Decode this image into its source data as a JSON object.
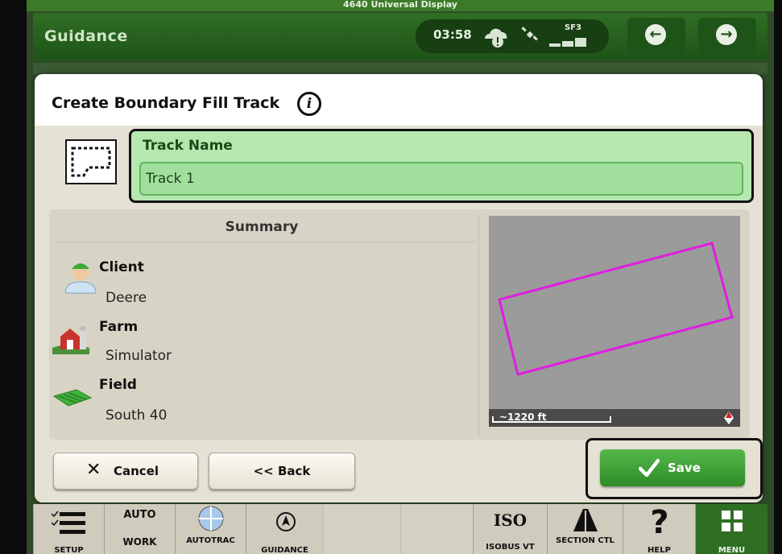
{
  "display_title": "4640 Universal Display",
  "header": {
    "title": "Guidance",
    "clock": "03:58",
    "gps_status": "SF3",
    "back_icon": "arrow-left-circle-icon",
    "forward_icon": "arrow-right-circle-icon"
  },
  "dialog": {
    "title": "Create Boundary Fill Track",
    "track_name_label": "Track Name",
    "track_name_value": "Track 1",
    "summary": {
      "title": "Summary",
      "items": [
        {
          "label": "Client",
          "value": "Deere",
          "icon": "client-person-icon"
        },
        {
          "label": "Farm",
          "value": "Simulator",
          "icon": "farm-barn-icon"
        },
        {
          "label": "Field",
          "value": "South 40",
          "icon": "field-icon"
        }
      ]
    },
    "map": {
      "scale": "~1220 ft",
      "boundary_color": "#e01ee0",
      "background_color": "#9b9b9b"
    },
    "buttons": {
      "cancel": "Cancel",
      "back": "<< Back",
      "save": "Save"
    }
  },
  "bottom_bar": {
    "items": [
      {
        "label": "SETUP"
      },
      {
        "label": "WORK",
        "top": "AUTO"
      },
      {
        "label": "AUTOTRAC"
      },
      {
        "label": "GUIDANCE"
      },
      {
        "label": ""
      },
      {
        "label": ""
      },
      {
        "label": "ISOBUS VT",
        "top": "ISO"
      },
      {
        "label": "SECTION CTL"
      },
      {
        "label": "HELP"
      },
      {
        "label": "MENU"
      }
    ]
  },
  "colors": {
    "john_deere_green": "#367c2b",
    "highlight_green": "#b6e7b1",
    "save_green": "#3f9e35"
  }
}
